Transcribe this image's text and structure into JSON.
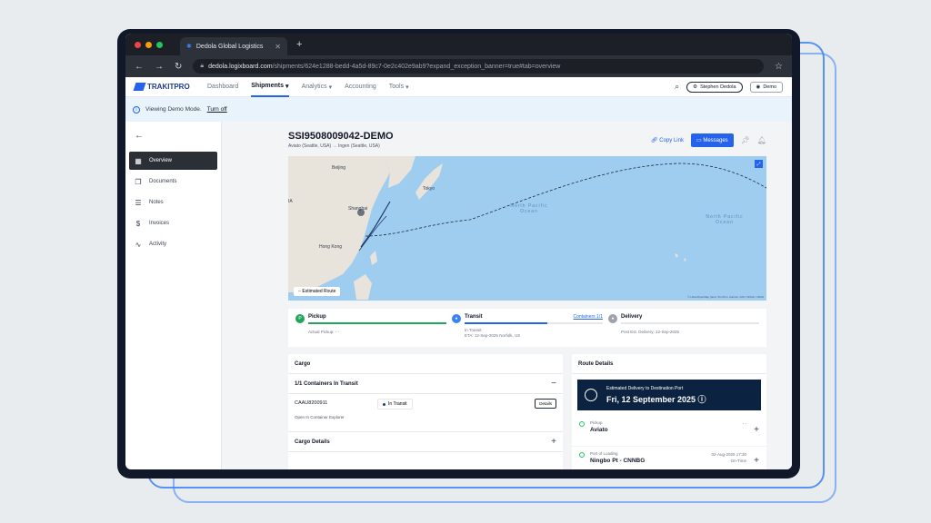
{
  "browser": {
    "tab_title": "Dedola Global Logistics",
    "url_host": "dedola.logixboard.com",
    "url_path": "/shipments/624e1288-bedd-4a5d-89c7-0e2c402e9ab9?expand_exception_banner=true#tab=overview"
  },
  "nav": {
    "logo": "TRAKITPRO",
    "items": [
      {
        "label": "Dashboard"
      },
      {
        "label": "Shipments",
        "caret": "▾"
      },
      {
        "label": "Analytics",
        "caret": "▾"
      },
      {
        "label": "Accounting"
      },
      {
        "label": "Tools",
        "caret": "▾"
      }
    ],
    "user": "Stephen Dedola",
    "demo": "Demo"
  },
  "banner": {
    "text": "Viewing Demo Mode.",
    "link": "Turn off"
  },
  "sidebar": {
    "items": [
      {
        "label": "Overview",
        "icon": "grid-icon"
      },
      {
        "label": "Documents",
        "icon": "documents-icon"
      },
      {
        "label": "Notes",
        "icon": "notes-icon"
      },
      {
        "label": "Invoices",
        "icon": "dollar-icon"
      },
      {
        "label": "Activity",
        "icon": "activity-icon"
      }
    ]
  },
  "shipment": {
    "id": "SSI9508009042-DEMO",
    "route": "Aviato (Seattle, USA) → Ingen (Seattle, USA)",
    "copy_link": "Copy Link",
    "messages": "Messages"
  },
  "map": {
    "labels": {
      "beijing": "Beijing",
      "tokyo": "Tokyo",
      "shanghai": "Shanghai",
      "hongkong": "Hong Kong",
      "china": "IA"
    },
    "ocean1": "North Pacific Ocean",
    "ocean2": "North Pacific Ocean",
    "estimated_route": "Estimated Route",
    "attribution": "© Libre/OpenMap | Esri, TomTom, Garmin, FAO, NOAA, USGS"
  },
  "progress": {
    "pickup": {
      "label": "Pickup",
      "sub": "Actual Pickup: - -",
      "fill": 1.0,
      "color": "#22a55a"
    },
    "transit": {
      "label": "Transit",
      "link": "Containers 1/1",
      "sub1": "In Transit",
      "sub2": "ETA: 12-Sep-2025   Norfolk, US",
      "fill": 0.6,
      "color": "#2563eb"
    },
    "delivery": {
      "label": "Delivery",
      "sub": "Post Est. Delivery: 12-Sep-2025",
      "fill": 0.0,
      "color": "#9ca3af"
    }
  },
  "cargo": {
    "title": "Cargo",
    "containers_header": "1/1 Containers In Transit",
    "container_number": "CAAU8200911",
    "status": "In Transit",
    "details": "Details",
    "open_explorer": "Open In Container Explorer",
    "cargo_details": "Cargo Details"
  },
  "route_details": {
    "title": "Route Details",
    "eta_label": "Estimated Delivery to Destination Port",
    "eta_date": "Fri, 12 September 2025 ⓘ",
    "steps": [
      {
        "label": "Pickup",
        "value": "Aviato",
        "meta1": "- -",
        "meta2": ""
      },
      {
        "label": "Port of Loading",
        "value": "Ningbo Pt - CNNBG",
        "meta1": "02-Aug-2025 17:30",
        "meta2": "On-Time"
      }
    ]
  }
}
